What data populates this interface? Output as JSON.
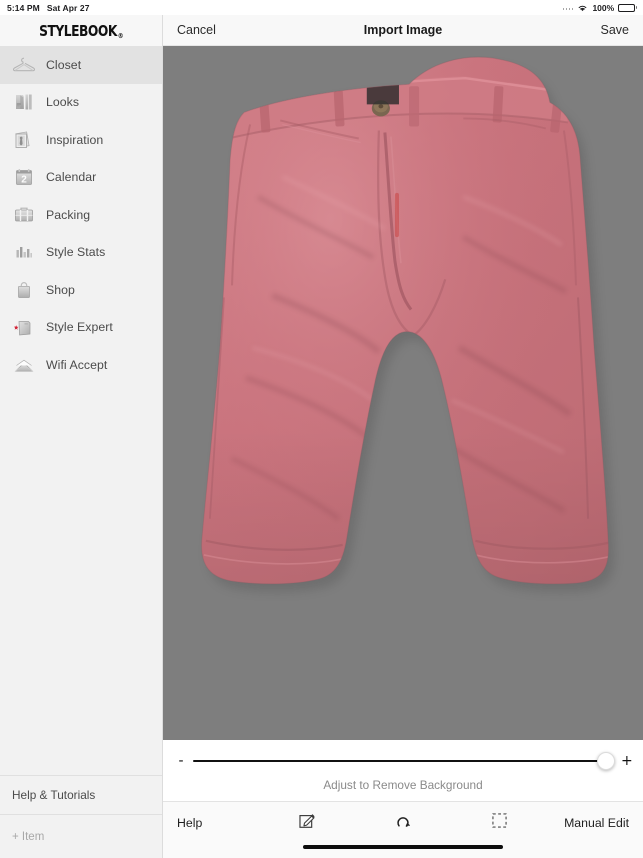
{
  "status_bar": {
    "time": "5:14 PM",
    "date": "Sat Apr 27",
    "battery_percent": "100%",
    "wifi_icon": "wifi-icon",
    "battery_icon": "battery-full-icon",
    "signal_icon": "signal-dots-icon"
  },
  "sidebar": {
    "logo": "STYLEBOOK",
    "logo_mark": "®",
    "items": [
      {
        "label": "Closet",
        "icon": "hanger-icon",
        "active": true
      },
      {
        "label": "Looks",
        "icon": "outfit-icon",
        "active": false
      },
      {
        "label": "Inspiration",
        "icon": "photos-icon",
        "active": false
      },
      {
        "label": "Calendar",
        "icon": "calendar-icon",
        "active": false
      },
      {
        "label": "Packing",
        "icon": "suitcase-icon",
        "active": false
      },
      {
        "label": "Style Stats",
        "icon": "bar-chart-icon",
        "active": false
      },
      {
        "label": "Shop",
        "icon": "shopping-bag-icon",
        "active": false
      },
      {
        "label": "Style Expert",
        "icon": "book-star-icon",
        "active": false
      },
      {
        "label": "Wifi Accept",
        "icon": "envelope-icon",
        "active": false
      }
    ],
    "help_label": "Help & Tutorials",
    "add_item_label": "+ Item"
  },
  "navbar": {
    "cancel_label": "Cancel",
    "title": "Import Image",
    "save_label": "Save"
  },
  "canvas": {
    "background_color": "#7e7e7e",
    "subject": "pink-chino-shorts-photo",
    "garment_color": "#c9707a"
  },
  "slider": {
    "minus_label": "-",
    "plus_label": "+",
    "value_percent": 100,
    "caption": "Adjust to Remove Background",
    "knob_icon": "slider-knob"
  },
  "toolbar": {
    "help_label": "Help",
    "manual_edit_label": "Manual Edit",
    "buttons": [
      {
        "name": "edit-pencil-square-icon",
        "icon": "pencil-in-square-icon"
      },
      {
        "name": "undo-icon",
        "icon": "undo-arrow-icon"
      },
      {
        "name": "crop-icon",
        "icon": "dashed-crop-square-icon"
      }
    ]
  },
  "home_indicator": "home-indicator-bar"
}
